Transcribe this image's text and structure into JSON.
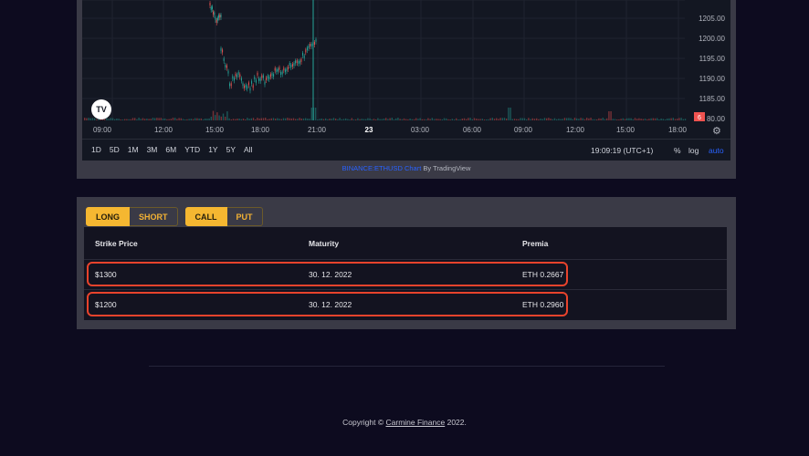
{
  "chart": {
    "price_ticks": [
      "1205.00",
      "1200.00",
      "1195.00",
      "1190.00",
      "1185.00",
      "80.00"
    ],
    "price_badge": "6",
    "time_ticks": [
      "09:00",
      "12:00",
      "15:00",
      "18:00",
      "21:00",
      "23",
      "03:00",
      "06:00",
      "09:00",
      "12:00",
      "15:00",
      "18:00"
    ],
    "tv_logo": "TV",
    "ranges": [
      "1D",
      "5D",
      "1M",
      "3M",
      "6M",
      "YTD",
      "1Y",
      "5Y",
      "All"
    ],
    "clock": "19:09:19 (UTC+1)",
    "percent_label": "%",
    "log_label": "log",
    "auto_label": "auto",
    "attribution_link": "BINANCE:ETHUSD Chart",
    "attribution_suffix": " By TradingView",
    "colors": {
      "candle_up": "#26a69a",
      "candle_down": "#ef5350",
      "auto": "#2962ff"
    }
  },
  "options": {
    "side_toggle": {
      "long": "LONG",
      "short": "SHORT",
      "active": "LONG"
    },
    "type_toggle": {
      "call": "CALL",
      "put": "PUT",
      "active": "CALL"
    },
    "columns": [
      "Strike Price",
      "Maturity",
      "Premia"
    ],
    "rows": [
      {
        "strike": "$1300",
        "maturity": "30. 12. 2022",
        "premia": "ETH 0.2667"
      },
      {
        "strike": "$1200",
        "maturity": "30. 12. 2022",
        "premia": "ETH 0.2960"
      }
    ],
    "colors": {
      "accent": "#f5b731",
      "highlight": "#e8432c"
    }
  },
  "footer": {
    "prefix": "Copyright © ",
    "link": "Carmine Finance",
    "suffix": " 2022."
  }
}
